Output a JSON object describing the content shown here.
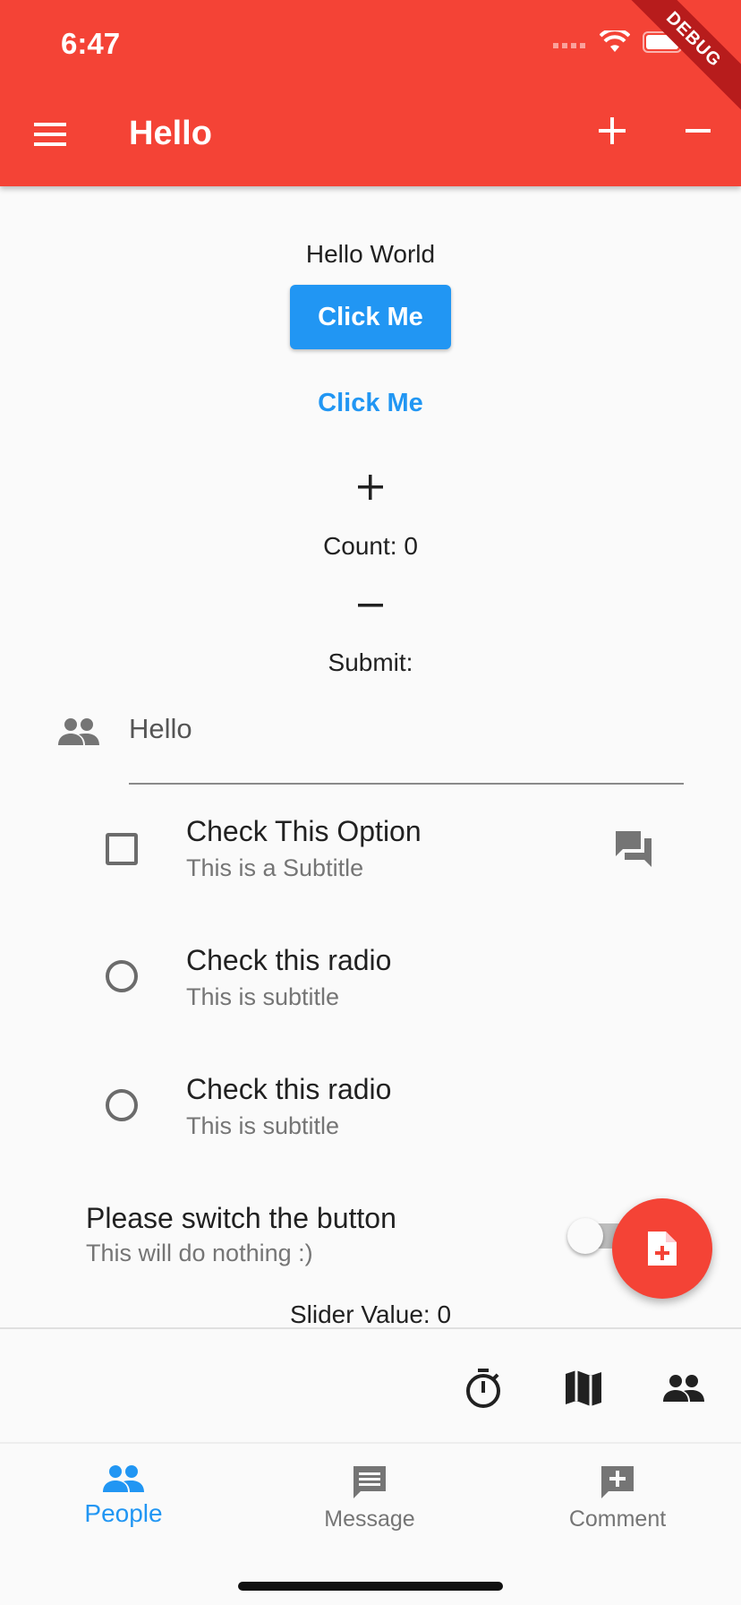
{
  "status_bar": {
    "time": "6:47",
    "debug_label": "DEBUG"
  },
  "app_bar": {
    "title": "Hello",
    "menu_icon": "menu-icon",
    "actions": [
      "add-icon",
      "remove-icon"
    ]
  },
  "main": {
    "hello_text": "Hello World",
    "raised_button_label": "Click Me",
    "flat_button_label": "Click Me",
    "count_text": "Count: 0",
    "submit_label": "Submit:",
    "text_field": {
      "value": "Hello",
      "icon": "people-icon"
    },
    "checkbox_tile": {
      "title": "Check This Option",
      "subtitle": "This is a Subtitle",
      "checked": false,
      "secondary_icon": "forum-icon"
    },
    "radio_tiles": [
      {
        "title": "Check this radio",
        "subtitle": "This is subtitle",
        "selected": false
      },
      {
        "title": "Check this radio",
        "subtitle": "This is subtitle",
        "selected": false
      }
    ],
    "switch_tile": {
      "title": "Please switch the button",
      "subtitle": "This will do nothing :)",
      "on": false
    },
    "slider_text": "Slider Value: 0"
  },
  "fab": {
    "icon": "note-add-icon"
  },
  "button_bar": {
    "icons": [
      "timer-icon",
      "map-icon",
      "people-icon"
    ]
  },
  "bottom_nav": {
    "items": [
      {
        "label": "People",
        "icon": "people-icon",
        "active": true
      },
      {
        "label": "Message",
        "icon": "message-icon",
        "active": false
      },
      {
        "label": "Comment",
        "icon": "add-comment-icon",
        "active": false
      }
    ]
  },
  "colors": {
    "primary": "#f44336",
    "accent": "#2196f3",
    "inactive": "#757575"
  }
}
